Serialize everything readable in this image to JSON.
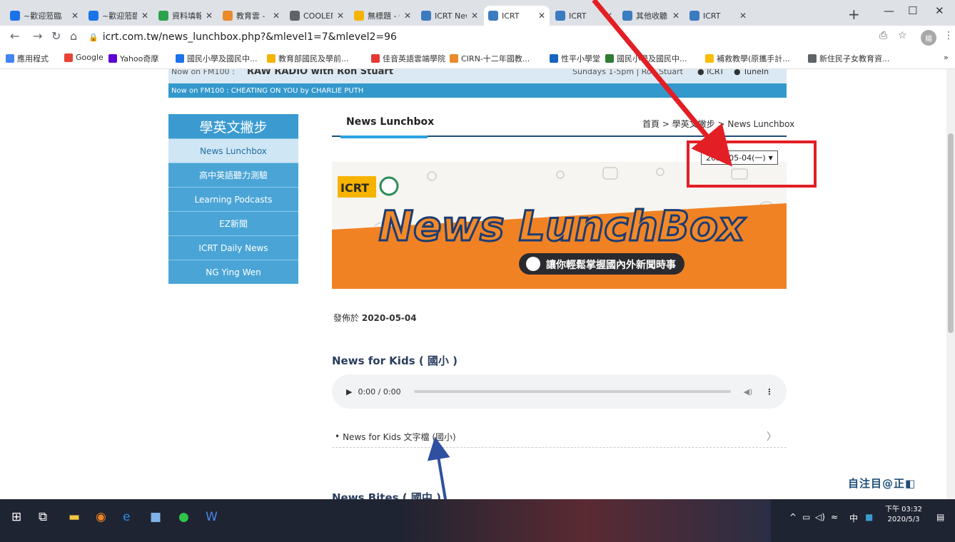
{
  "browser": {
    "tabs": [
      {
        "label": "~歡迎蒞臨",
        "color": "#1a73e8"
      },
      {
        "label": "~歡迎蒞臨",
        "color": "#1a73e8"
      },
      {
        "label": "資料填報",
        "color": "#2ba24c"
      },
      {
        "label": "教育雲 - ",
        "color": "#e98b2a"
      },
      {
        "label": "COOLENG",
        "color": "#5f6368"
      },
      {
        "label": "無標題 - G",
        "color": "#f4b400"
      },
      {
        "label": "ICRT New",
        "color": "#3b7bbf"
      },
      {
        "label": "ICRT",
        "color": "#3b7bbf"
      },
      {
        "label": "ICRT",
        "color": "#3b7bbf"
      },
      {
        "label": "其他收聽",
        "color": "#3b7bbf"
      },
      {
        "label": "ICRT",
        "color": "#3b7bbf"
      }
    ],
    "url": "icrt.com.tw/news_lunchbox.php?&mlevel1=7&mlevel2=96",
    "profile_initial": "楊",
    "bookmarks": [
      {
        "label": "應用程式",
        "color": "#4285f4"
      },
      {
        "label": "Google",
        "color": "#ea4335"
      },
      {
        "label": "Yahoo奇摩",
        "color": "#6001d2"
      },
      {
        "label": "國民小學及國民中...",
        "color": "#1a73e8"
      },
      {
        "label": "教育部國民及學前...",
        "color": "#f4b400"
      },
      {
        "label": "佳音英語雲端學院",
        "color": "#e53935"
      },
      {
        "label": "CIRN-十二年國教...",
        "color": "#e98b2a"
      },
      {
        "label": "性平小學堂",
        "color": "#1565c0"
      },
      {
        "label": "國民小學及國民中...",
        "color": "#2e7d32"
      },
      {
        "label": "補救教學(原攜手計...",
        "color": "#fbbc04"
      },
      {
        "label": "新住民子女教育資...",
        "color": "#5f6368"
      }
    ]
  },
  "page": {
    "radio_now": "Now on FM100 :",
    "radio_show": "RAW RADIO with Ron Stuart",
    "radio_time": "Sundays 1-5pm | Ron Stuart",
    "radio_icrt": "ICRT",
    "radio_tunein": "TuneIn",
    "now_playing": "Now on FM100 : CHEATING ON YOU by CHARLIE PUTH",
    "sidebar_title": "學英文撇步",
    "sidebar_items": [
      "News Lunchbox",
      "高中英語聽力測驗",
      "Learning Podcasts",
      "EZ新聞",
      "ICRT Daily News",
      "NG Ying Wen"
    ],
    "content_title": "News Lunchbox",
    "breadcrumb": "首頁 > 學英文撇步 > News Lunchbox",
    "date_selected": "2020-05-04(一)",
    "banner_title": "News LunchBox",
    "banner_subtitle": "讓你輕鬆掌握國內外新聞時事",
    "banner_logo": "ICRT",
    "published_label": "發佈於",
    "published_date": "2020-05-04",
    "section1_title": "News for Kids ( 國小 )",
    "audio_time": "0:00 / 0:00",
    "link1": "News for Kids 文字檔 (國小)",
    "section2_title": "News Bites ( 國中 )",
    "ime_toolbar": "自注目@正◧"
  },
  "taskbar": {
    "clock_time": "下午 03:32",
    "clock_date": "2020/5/3",
    "ime_lang": "中"
  }
}
